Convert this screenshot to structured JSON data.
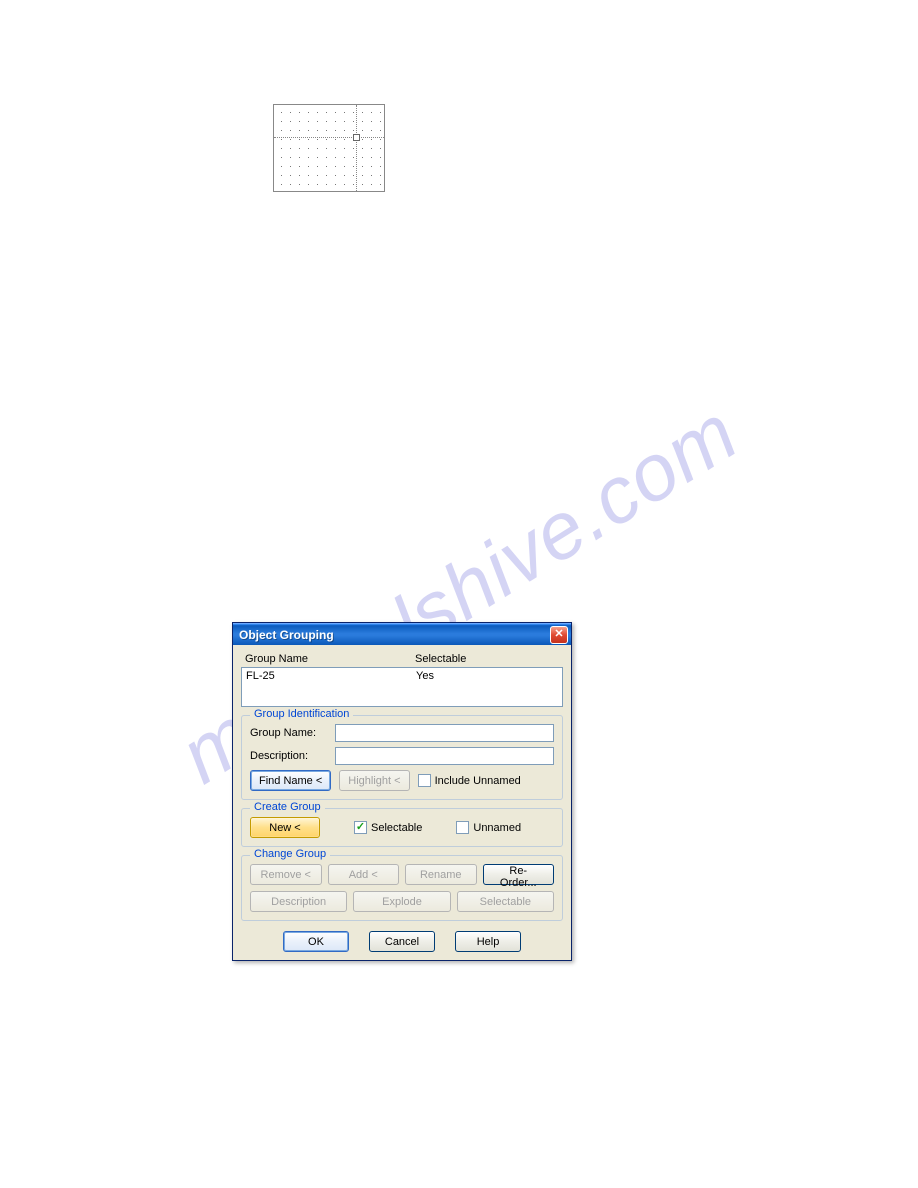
{
  "watermark": "manualshive.com",
  "dialog": {
    "title": "Object Grouping",
    "list_header_name": "Group Name",
    "list_header_selectable": "Selectable",
    "list_rows": [
      {
        "name": "FL-25",
        "selectable": "Yes"
      }
    ],
    "identification": {
      "title": "Group Identification",
      "name_label": "Group Name:",
      "name_value": "",
      "desc_label": "Description:",
      "desc_value": "",
      "find_name_btn": "Find Name <",
      "highlight_btn": "Highlight <",
      "include_unnamed_label": "Include Unnamed",
      "include_unnamed_checked": false
    },
    "create": {
      "title": "Create Group",
      "new_btn": "New <",
      "selectable_label": "Selectable",
      "selectable_checked": true,
      "unnamed_label": "Unnamed",
      "unnamed_checked": false
    },
    "change": {
      "title": "Change Group",
      "remove_btn": "Remove <",
      "add_btn": "Add <",
      "rename_btn": "Rename",
      "reorder_btn": "Re-Order...",
      "description_btn": "Description",
      "explode_btn": "Explode",
      "selectable_btn": "Selectable"
    },
    "footer": {
      "ok_btn": "OK",
      "cancel_btn": "Cancel",
      "help_btn": "Help"
    }
  }
}
